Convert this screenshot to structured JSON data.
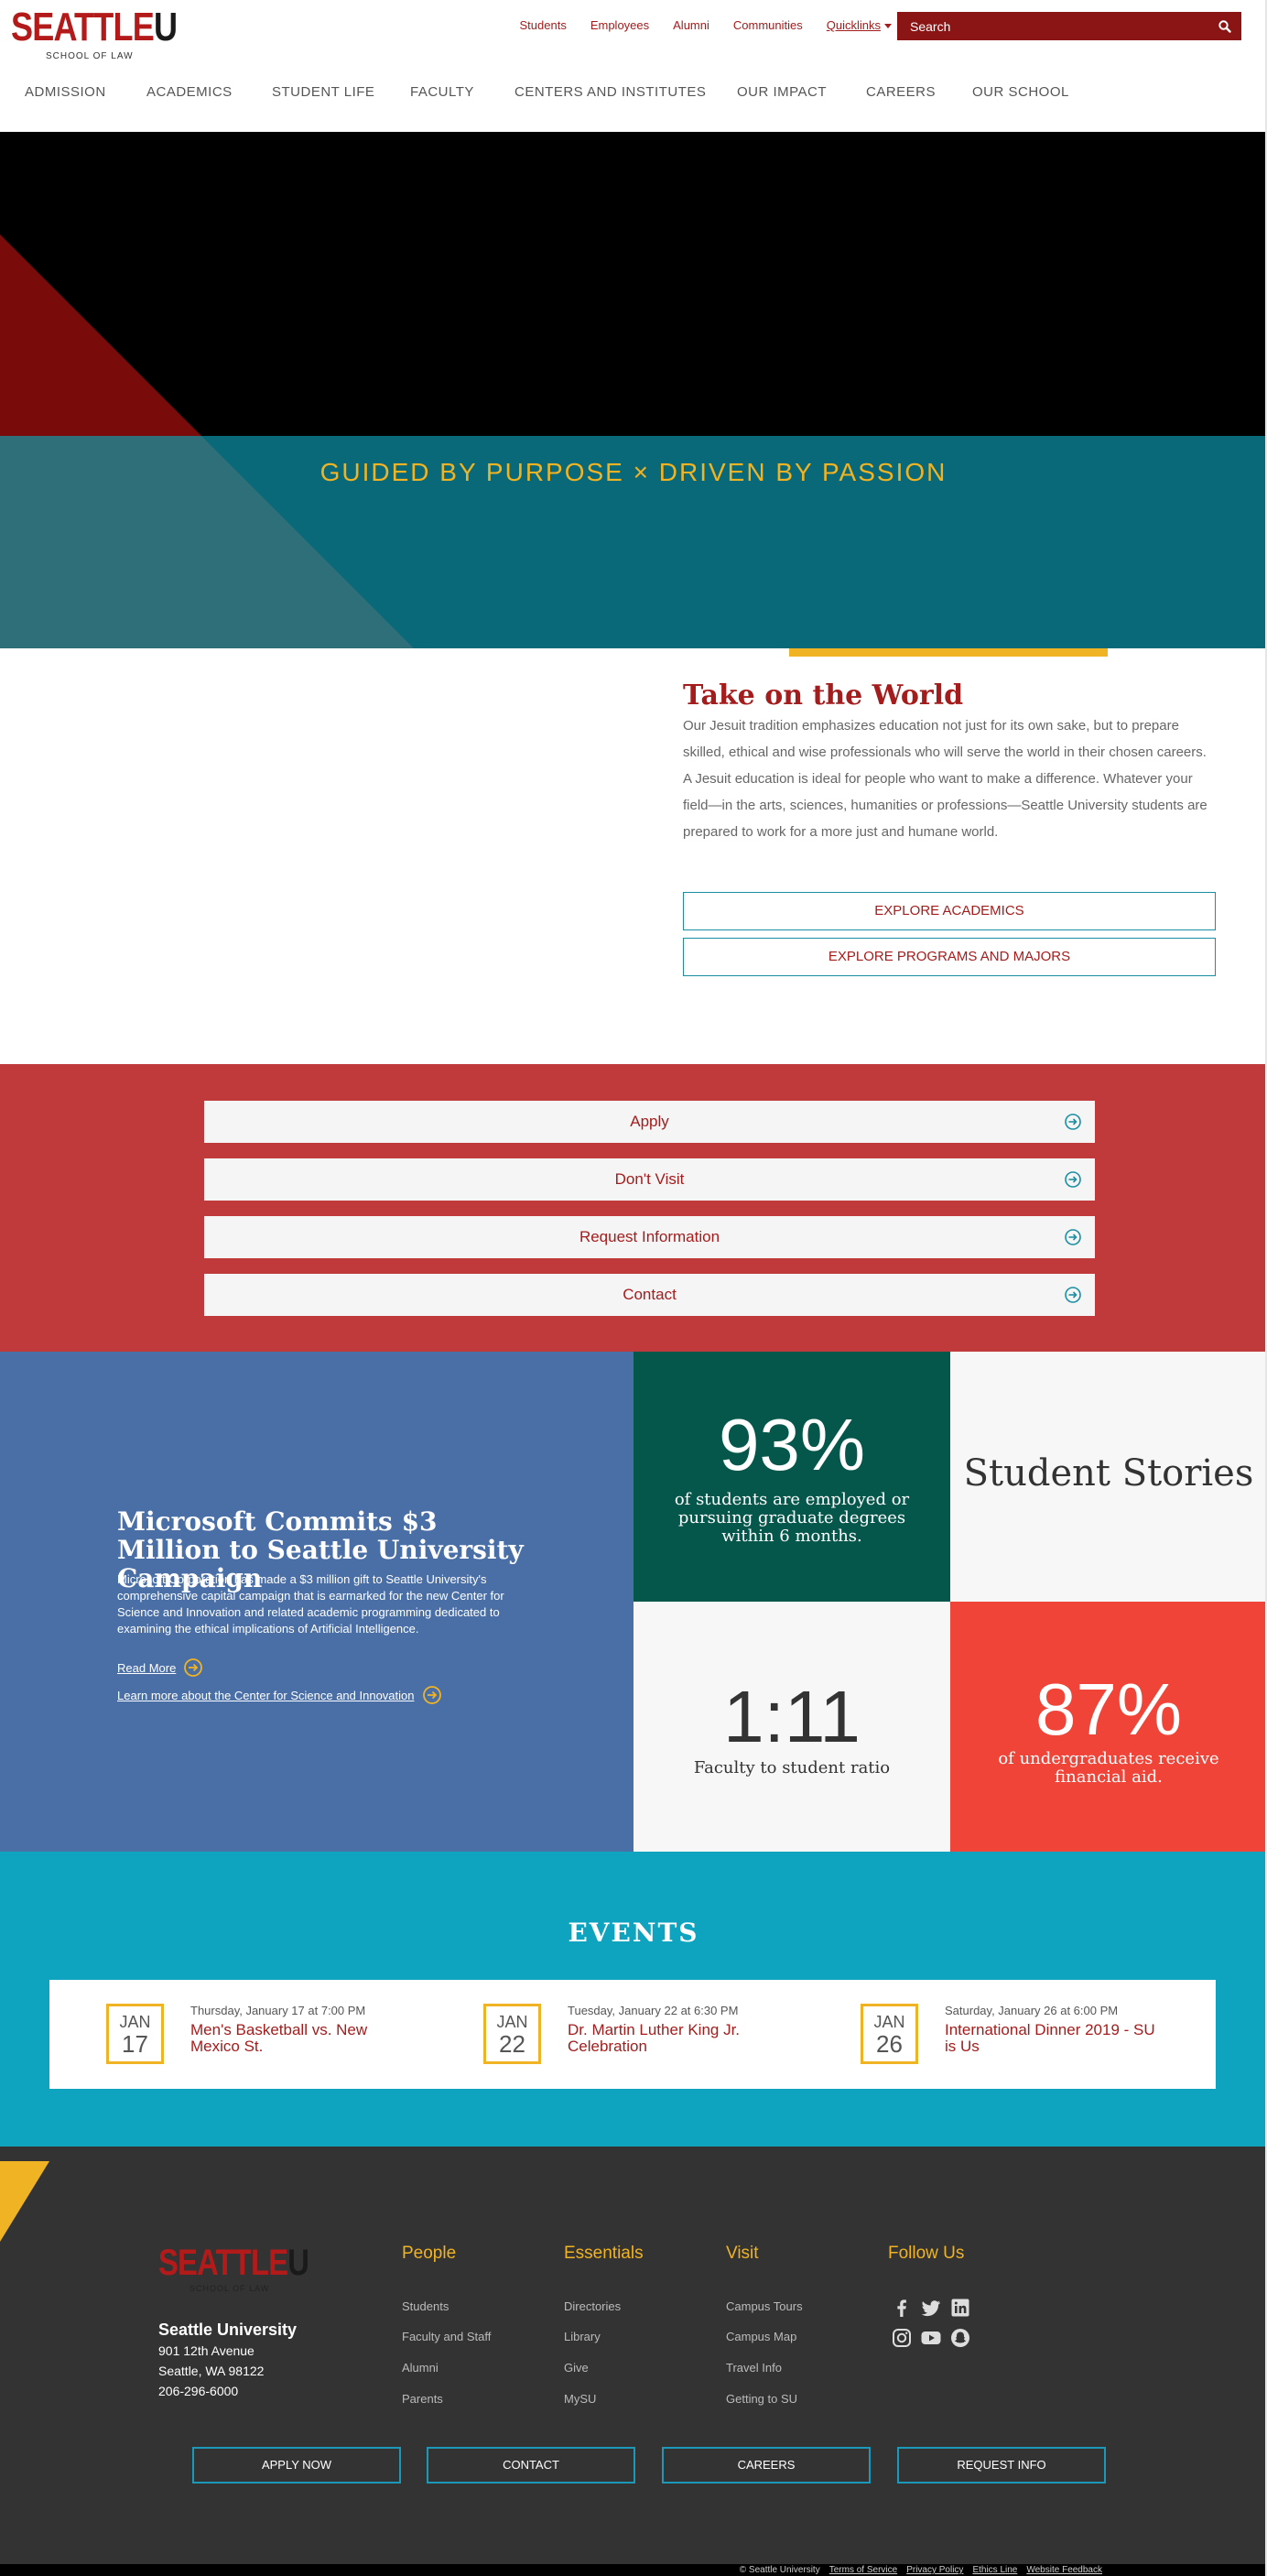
{
  "header": {
    "logo_word": "SEATTLE",
    "logo_letter": "U",
    "logo_sub": "SCHOOL OF LAW",
    "util_links": [
      "Students",
      "Employees",
      "Alumni",
      "Communities"
    ],
    "quicklinks_label": "Quicklinks",
    "search_placeholder": "Search"
  },
  "nav": {
    "items": [
      "ADMISSION",
      "ACADEMICS",
      "STUDENT LIFE",
      "FACULTY",
      "CENTERS AND INSTITUTES",
      "OUR IMPACT",
      "CAREERS",
      "OUR SCHOOL"
    ]
  },
  "hero": {
    "tagline": "GUIDED BY PURPOSE × DRIVEN BY PASSION"
  },
  "intro": {
    "title": "Take on the World",
    "body": "Our Jesuit tradition emphasizes education not just for its own sake, but to prepare skilled, ethical and wise professionals who will serve the world in their chosen careers. A Jesuit education is ideal for people who want to make a difference. Whatever your field—in the arts, sciences, humanities or professions—Seattle University students are prepared to work for a more just and humane world.",
    "buttons": [
      "EXPLORE ACADEMICS",
      "EXPLORE PROGRAMS AND MAJORS"
    ]
  },
  "cta": {
    "buttons": [
      "Apply",
      "Don't Visit",
      "Request Information",
      "Contact"
    ]
  },
  "news": {
    "title": "Microsoft Commits $3 Million to Seattle University Campaign",
    "body": "Microsoft Corporation has made a $3 million gift to Seattle University's comprehensive capital campaign that is earmarked for the new Center for Science and Innovation and related academic programming dedicated to examining the ethical implications of Artificial Intelligence.",
    "read_more": "Read More",
    "learn_more": "Learn more about the Center for Science and Innovation"
  },
  "stats": {
    "employed_value": "93%",
    "employed_text": "of students are employed or pursuing graduate degrees within 6 months.",
    "stories_label": "Student Stories",
    "ratio_value": "1:11",
    "ratio_text": "Faculty to student ratio",
    "aid_value": "87%",
    "aid_text": "of undergraduates receive financial aid."
  },
  "events": {
    "title": "EVENTS",
    "items": [
      {
        "month": "JAN",
        "day": "17",
        "when": "Thursday, January 17 at 7:00 PM",
        "name": "Men's Basketball vs. New Mexico St."
      },
      {
        "month": "JAN",
        "day": "22",
        "when": "Tuesday, January 22 at 6:30 PM",
        "name": "Dr. Martin Luther King Jr. Celebration"
      },
      {
        "month": "JAN",
        "day": "26",
        "when": "Saturday, January 26 at 6:00 PM",
        "name": "International Dinner 2019 - SU is Us"
      }
    ]
  },
  "footer": {
    "logo_word": "SEATTLE",
    "logo_letter": "U",
    "logo_sub": "SCHOOL OF LAW",
    "org": "Seattle University",
    "address": [
      "901 12th Avenue",
      "Seattle, WA 98122",
      "206-296-6000"
    ],
    "columns": [
      {
        "heading": "People",
        "links": [
          "Students",
          "Faculty and Staff",
          "Alumni",
          "Parents"
        ]
      },
      {
        "heading": "Essentials",
        "links": [
          "Directories",
          "Library",
          "Give",
          "MySU"
        ]
      },
      {
        "heading": "Visit",
        "links": [
          "Campus Tours",
          "Campus Map",
          "Travel Info",
          "Getting to SU"
        ]
      }
    ],
    "follow_heading": "Follow Us",
    "social_icons": [
      "facebook-icon",
      "twitter-icon",
      "linkedin-icon",
      "instagram-icon",
      "youtube-icon",
      "snapchat-icon"
    ],
    "buttons": [
      "APPLY NOW",
      "CONTACT",
      "CAREERS",
      "REQUEST INFO"
    ],
    "bottom": {
      "copyright": "© Seattle University",
      "links": [
        "Terms of Service",
        "Privacy Policy",
        "Ethics Line",
        "Website Feedback"
      ]
    }
  },
  "colors": {
    "brand_red": "#a51c1c",
    "gold": "#f0b323",
    "teal": "#096978",
    "cta_red": "#c0393b",
    "news_blue": "#4a6fa6",
    "stat_green": "#06574b",
    "stat_red": "#f04438",
    "events_blue": "#0ea4c0",
    "footer_grey": "#333333"
  }
}
